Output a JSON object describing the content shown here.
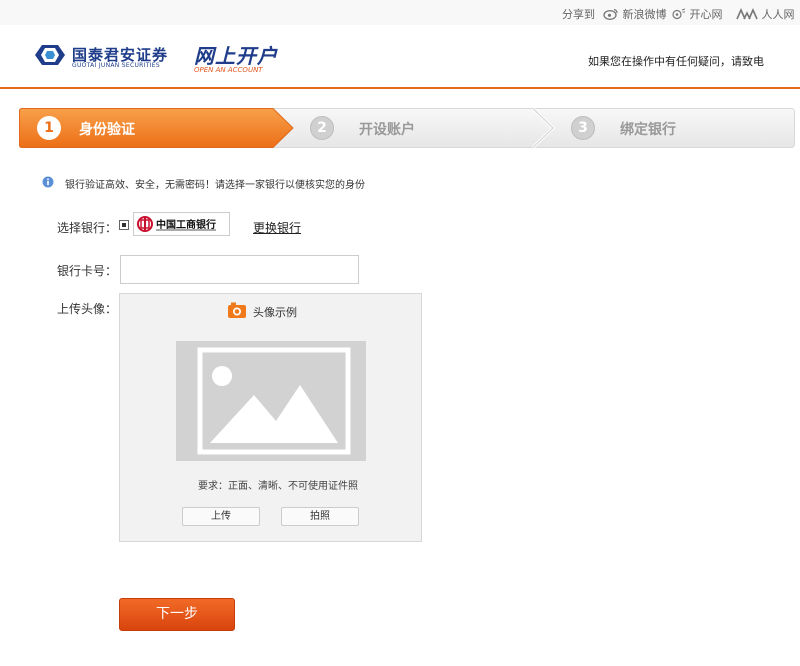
{
  "share": {
    "label": "分享到",
    "items": [
      {
        "name": "weibo",
        "label": "新浪微博"
      },
      {
        "name": "kaixin",
        "label": "开心网"
      },
      {
        "name": "renren",
        "label": "人人网"
      }
    ]
  },
  "header": {
    "brand_cn": "国泰君安证券",
    "brand_en": "GUOTAI JUNAN SECURITIES",
    "product_cn": "网上开户",
    "product_en": "OPEN AN ACCOUNT",
    "note": "如果您在操作中有任何疑问，请致电"
  },
  "steps": [
    {
      "num": "1",
      "label": "身份验证",
      "active": true
    },
    {
      "num": "2",
      "label": "开设账户",
      "active": false
    },
    {
      "num": "3",
      "label": "绑定银行",
      "active": false
    }
  ],
  "info": "银行验证高效、安全，无需密码！请选择一家银行以便核实您的身份",
  "form": {
    "bank_label": "选择银行：",
    "bank_name": "中国工商银行",
    "change_bank": "更换银行",
    "card_label": "银行卡号：",
    "card_value": "",
    "card_placeholder": "",
    "avatar_label": "上传头像：",
    "avatar_sample": "头像示例",
    "requirement": "要求：正面、清晰、不可使用证件照",
    "upload_button": "上传",
    "photo_button": "拍照"
  },
  "next_button": "下一步",
  "colors": {
    "accent": "#e66a1a",
    "brand_blue": "#1f3d8a",
    "step_inactive": "#eeeeee"
  }
}
